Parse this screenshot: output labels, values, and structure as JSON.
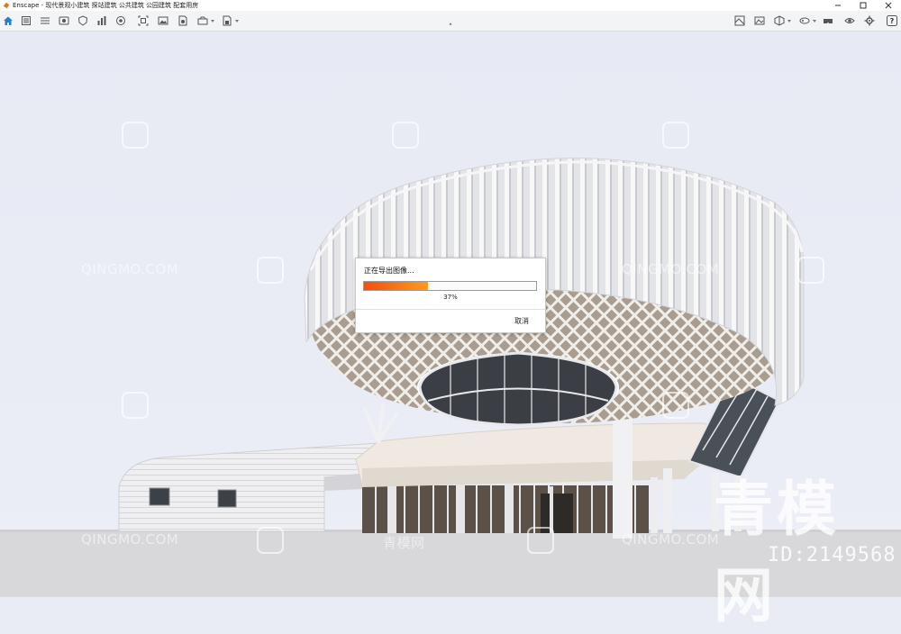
{
  "window": {
    "title": "Enscape - 现代景观小建筑 探站建筑 公共建筑 公园建筑 配套用房",
    "controls": [
      "minimize-icon",
      "maximize-icon",
      "close-icon"
    ]
  },
  "toolbar": {
    "left_tools": [
      "home-icon",
      "capture-list-icon",
      "views-list-icon",
      "visual-settings-icon",
      "safe-frame-icon",
      "asset-library-icon",
      "sun-position-icon",
      "batch-render-icon",
      "screenshot-icon",
      "video-editor-icon",
      "export-icon",
      "save-file-icon"
    ],
    "right_tools": [
      "material-editor-icon",
      "image-icon",
      "cube-icon",
      "vr-headset-icon",
      "vr-mode-icon",
      "view-mode-icon",
      "settings-gear-icon",
      "help-icon"
    ],
    "collapse_glyph": "˄",
    "help_glyph": "?"
  },
  "dialog": {
    "title": "正在导出图像...",
    "progress": 0.37,
    "progress_label": "37%",
    "cancel_label": "取消"
  },
  "watermarks": {
    "brand": "QINGMO.COM",
    "brand_cn": "青模网",
    "big_text": "青模网",
    "id_text": "ID:2149568"
  },
  "colors": {
    "progress_start": "#f05010",
    "progress_end": "#ff9a1a",
    "sky": "#e9ecf5",
    "ground": "#d9d9dc",
    "accent_home": "#1f7fd6"
  }
}
